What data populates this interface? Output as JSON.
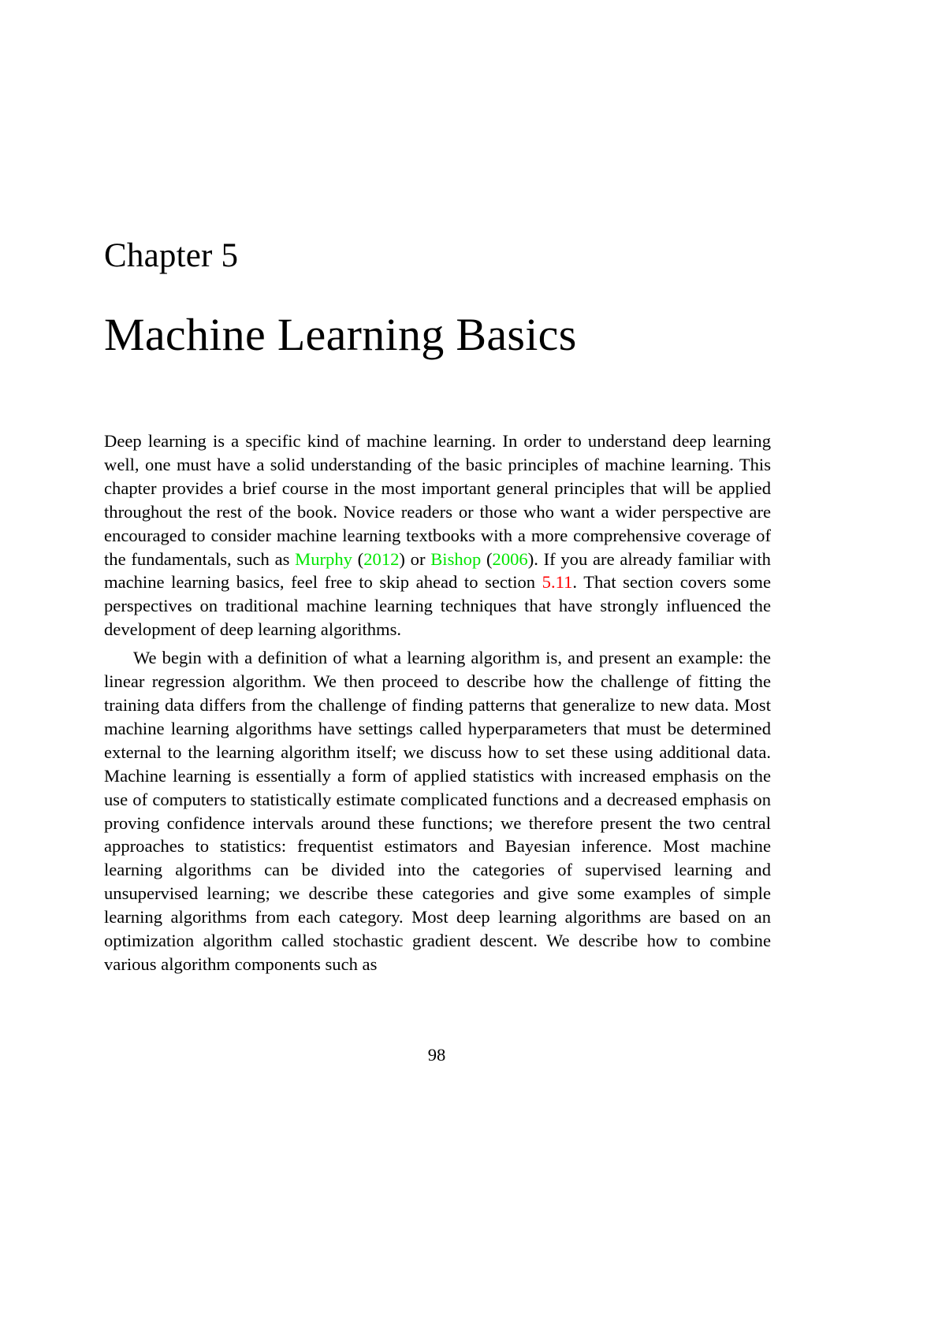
{
  "chapter": {
    "label": "Chapter 5",
    "title": "Machine Learning Basics"
  },
  "paragraphs": [
    {
      "segments": [
        {
          "type": "text",
          "text": "Deep learning is a specific kind of machine learning.  In order to understand deep learning well, one must have a solid understanding of the basic principles of machine learning.  This chapter provides a brief course in the most important general principles that will be applied throughout the rest of the book. Novice readers or those who want a wider perspective are encouraged to consider machine learning textbooks with a more comprehensive coverage of the fundamentals, such as "
        },
        {
          "type": "cite",
          "text": "Murphy"
        },
        {
          "type": "text",
          "text": " ("
        },
        {
          "type": "cite",
          "text": "2012"
        },
        {
          "type": "text",
          "text": ") or "
        },
        {
          "type": "cite",
          "text": "Bishop"
        },
        {
          "type": "text",
          "text": " ("
        },
        {
          "type": "cite",
          "text": "2006"
        },
        {
          "type": "text",
          "text": "). If you are already familiar with machine learning basics, feel free to skip ahead to section "
        },
        {
          "type": "ref",
          "text": "5.11"
        },
        {
          "type": "text",
          "text": ".  That section covers some perspectives on traditional machine learning techniques that have strongly influenced the development of deep learning algorithms."
        }
      ]
    },
    {
      "segments": [
        {
          "type": "text",
          "text": "We begin with a definition of what a learning algorithm is, and present an example: the linear regression algorithm. We then proceed to describe how the challenge of fitting the training data differs from the challenge of finding patterns that generalize to new data.  Most machine learning algorithms have settings called hyperparameters that must be determined external to the learning algorithm itself; we discuss how to set these using additional data.  Machine learning is essentially a form of applied statistics with increased emphasis on the use of computers to statistically estimate complicated functions and a decreased emphasis on proving confidence intervals around these functions; we therefore present the two central approaches to statistics: frequentist estimators and Bayesian inference. Most machine learning algorithms can be divided into the categories of supervised learning and unsupervised learning; we describe these categories and give some examples of simple learning algorithms from each category. Most deep learning algorithms are based on an optimization algorithm called stochastic gradient descent.  We describe how to combine various algorithm components such as"
        }
      ]
    }
  ],
  "page_number": "98",
  "colors": {
    "citation_link": "#00e600",
    "reference_link": "#ff0000",
    "text": "#000000"
  }
}
